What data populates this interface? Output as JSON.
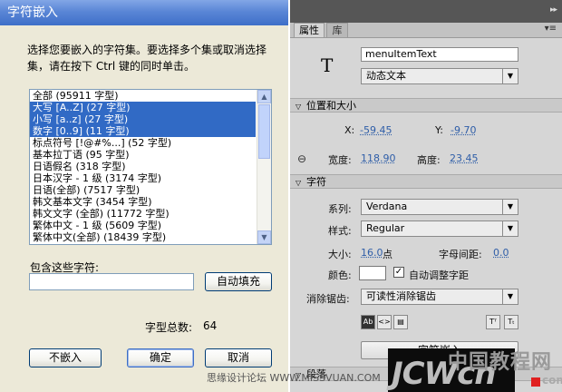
{
  "dialog": {
    "title": "字符嵌入",
    "description": "选择您要嵌入的字符集。要选择多个集或取消选择集，请在按下 Ctrl 键的同时单击。",
    "char_sets": [
      {
        "label": "全部  (95911 字型)",
        "selected": false
      },
      {
        "label": "大写 [A..Z]  (27 字型)",
        "selected": true
      },
      {
        "label": "小写 [a..z]  (27 字型)",
        "selected": true
      },
      {
        "label": "数字 [0..9]  (11 字型)",
        "selected": true
      },
      {
        "label": "标点符号 [!@#%...]  (52 字型)",
        "selected": false
      },
      {
        "label": "基本拉丁语  (95 字型)",
        "selected": false
      },
      {
        "label": "日语假名  (318 字型)",
        "selected": false
      },
      {
        "label": "日本汉字 - 1 级 (3174 字型)",
        "selected": false
      },
      {
        "label": "日语(全部)  (7517 字型)",
        "selected": false
      },
      {
        "label": "韩文基本文字 (3454 字型)",
        "selected": false
      },
      {
        "label": "韩文文字 (全部)  (11772 字型)",
        "selected": false
      },
      {
        "label": "繁体中文 - 1 级 (5609 字型)",
        "selected": false
      },
      {
        "label": "繁体中文(全部)  (18439 字型)",
        "selected": false
      }
    ],
    "include_label": "包含这些字符:",
    "include_value": "",
    "autofill_label": "自动填充",
    "glyph_count_label": "字型总数:",
    "glyph_count_value": "64",
    "no_embed_label": "不嵌入",
    "ok_label": "确定",
    "cancel_label": "取消"
  },
  "panel": {
    "tabs": [
      {
        "label": "属性",
        "active": true
      },
      {
        "label": "库",
        "active": false
      }
    ],
    "instance_name": "menuItemText",
    "text_type": "动态文本",
    "sections": {
      "position": "位置和大小",
      "character": "字符",
      "paragraph": "段落"
    },
    "position": {
      "x_label": "X:",
      "x_value": "-59.45",
      "y_label": "Y:",
      "y_value": "-9.70",
      "w_label": "宽度:",
      "w_value": "118.90",
      "h_label": "高度:",
      "h_value": "23.45"
    },
    "character": {
      "family_label": "系列:",
      "family_value": "Verdana",
      "style_label": "样式:",
      "style_value": "Regular",
      "size_label": "大小:",
      "size_value": "16.0",
      "size_unit": "点",
      "spacing_label": "字母间距:",
      "spacing_value": "0.0",
      "color_label": "颜色:",
      "text_color": "#ffffff",
      "autokern_label": "自动调整字距",
      "autokern_checked": true,
      "aa_label": "消除锯齿:",
      "aa_value": "可读性消除锯齿",
      "embed_label": "字符嵌入"
    },
    "t_glyph": "T",
    "menu_glyph": "▾≡",
    "collapse_glyph": "▸▸"
  },
  "watermark": {
    "cn": "中国教程网",
    "en": "JCWcn",
    "com": "com",
    "site": "思缘设计论坛 WWW.MISSVUAN.COM"
  },
  "colors": {
    "selection": "#316ac5",
    "title_bar": "#3e6fc8",
    "panel_bg": "#d6d6d6",
    "link_value": "#2f5ea8"
  }
}
